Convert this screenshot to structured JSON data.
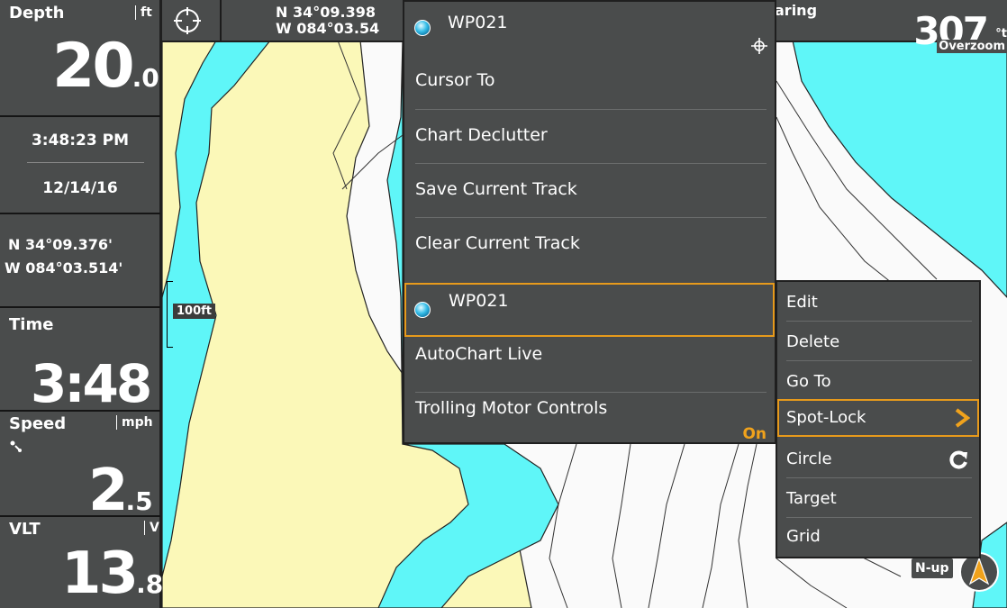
{
  "sidebar": {
    "depth": {
      "label": "Depth",
      "unit": "ft",
      "int": "20",
      "dec": ".0"
    },
    "clock": "3:48:23 PM",
    "date": "12/14/16",
    "lat": "N 34°09.376'",
    "lon": "W 084°03.514'",
    "time": {
      "label": "Time",
      "value": "3:48"
    },
    "speed": {
      "label": "Speed",
      "unit": "mph",
      "int": "2",
      "dec": ".5"
    },
    "vlt": {
      "label": "VLT",
      "unit": "V",
      "int": "13",
      "dec": ".8"
    }
  },
  "topbar": {
    "lat": "N 34°09.398",
    "lon": "W 084°03.54",
    "bearing_label": "aring",
    "bearing_value": "307",
    "bearing_unit": "°t",
    "overzoom": "Overzoom"
  },
  "map": {
    "scale": "100ft",
    "orientation": "N-up",
    "colors": {
      "land": "#fbf8b8",
      "shallow_water": "#5ff6f8",
      "deep_water": "#fafafa",
      "menu_bg": "#4a4c4c",
      "highlight": "#e79a1c"
    }
  },
  "menu": {
    "header": "WP021",
    "items": [
      "Cursor To",
      "Chart Declutter",
      "Save Current Track",
      "Clear Current Track",
      "WP021",
      "AutoChart Live",
      "Trolling Motor Controls"
    ],
    "trolling_status": "On"
  },
  "submenu": {
    "items": [
      "Edit",
      "Delete",
      "Go To",
      "Spot-Lock",
      "Circle",
      "Target",
      "Grid"
    ]
  }
}
